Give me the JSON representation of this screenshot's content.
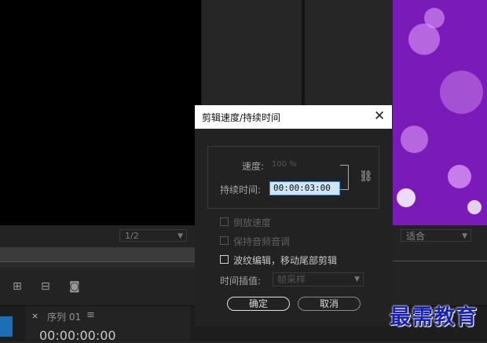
{
  "dialog": {
    "title": "剪辑速度/持续时间",
    "speed_label": "速度:",
    "speed_value": "100 %",
    "duration_label": "持续时间:",
    "duration_value": "00:00:03:00",
    "reverse_speed": "倒放速度",
    "maintain_audio_pitch": "保持音频音调",
    "ripple_edit": "波纹编辑，移动尾部剪辑",
    "interpolation_label": "时间插值:",
    "interpolation_value": "帧采样",
    "ok_label": "确定",
    "cancel_label": "取消"
  },
  "background": {
    "resolution": "1/2",
    "fit": "适合",
    "sequence_tab": "序列 01",
    "sequence_timecode": "00:00:00:00"
  },
  "watermark": "最需教育",
  "colors": {
    "accent": "#3b8ede",
    "program_bg": "#7a1ab8",
    "watermark": "#1a22b5"
  }
}
